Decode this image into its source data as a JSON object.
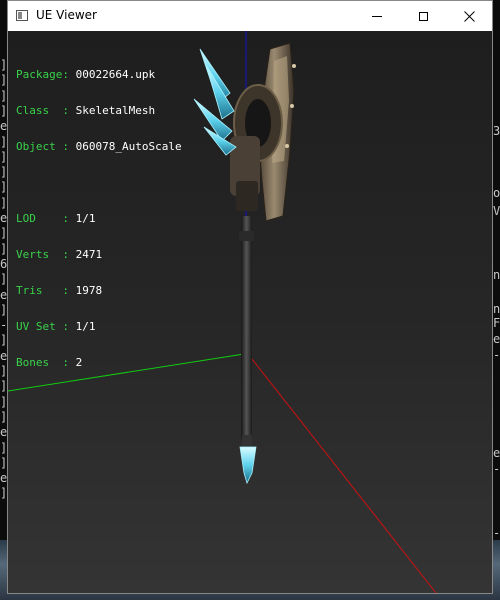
{
  "window": {
    "title": "UE Viewer"
  },
  "mesh_info": {
    "package_label": "Package: ",
    "package_value": "00022664.upk",
    "class_label": "Class  : ",
    "class_value": "SkeletalMesh",
    "object_label": "Object : ",
    "object_value": "060078_AutoScale",
    "lod_label": "LOD    : ",
    "lod_value": "1/1",
    "verts_label": "Verts  : ",
    "verts_value": "2471",
    "tris_label": "Tris   : ",
    "tris_value": "1978",
    "uvset_label": "UV Set : ",
    "uvset_value": "1/1",
    "bones_label": "Bones  : ",
    "bones_value": "2"
  },
  "axes": {
    "x_color": "#cc1111",
    "y_color": "#11cc11",
    "z_color": "#1111cc"
  },
  "background_text": {
    "left_chars": [
      "]",
      "]",
      "]",
      "]",
      "e",
      "]",
      "]",
      "]",
      "]",
      "]",
      "e",
      "]",
      "]",
      "6",
      "]",
      "e",
      "]",
      "-",
      "]",
      "e",
      "]",
      "]",
      "]",
      "]",
      "e",
      "]",
      "]",
      "e",
      "]"
    ],
    "right_chars": [
      "3",
      "o",
      "V",
      "n",
      "n",
      "F",
      "e",
      "-",
      "e",
      "-",
      "-"
    ]
  }
}
